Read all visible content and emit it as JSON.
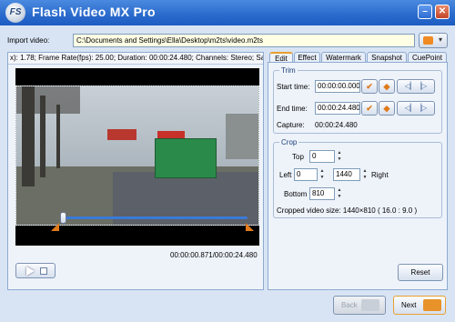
{
  "app": {
    "title": "Flash Video MX Pro",
    "logo_text": "FS"
  },
  "import": {
    "label": "Import video:",
    "path": "C:\\Documents and Settings\\Ella\\Desktop\\m2ts\\video.m2ts"
  },
  "info_bar": "x): 1.78;  Frame Rate(fps): 25.00;  Duration: 00:00:24.480;  Channels: Stereo;  Sa",
  "playback": {
    "time": "00:00:00.871/00:00:24.480",
    "position_fraction": 0.035
  },
  "tabs": [
    {
      "label": "Edit",
      "active": true
    },
    {
      "label": "Effect",
      "active": false
    },
    {
      "label": "Watermark",
      "active": false
    },
    {
      "label": "Snapshot",
      "active": false
    },
    {
      "label": "CuePoint",
      "active": false
    }
  ],
  "trim": {
    "title": "Trim",
    "start_label": "Start time:",
    "start_value": "00:00:00.000",
    "end_label": "End time:",
    "end_value": "00:00:24.480",
    "capture_label": "Capture:",
    "capture_value": "00:00:24.480"
  },
  "crop": {
    "title": "Crop",
    "top_label": "Top",
    "top_value": "0",
    "left_label": "Left",
    "left_value": "0",
    "right_label": "Right",
    "right_value": "1440",
    "bottom_label": "Bottom",
    "bottom_value": "810",
    "size_text": "Cropped video size: 1440×810 ( 16.0 : 9.0 )"
  },
  "buttons": {
    "reset": "Reset",
    "back": "Back",
    "next": "Next"
  },
  "colors": {
    "accent_orange": "#e8922a",
    "title_blue": "#2a6acc"
  }
}
